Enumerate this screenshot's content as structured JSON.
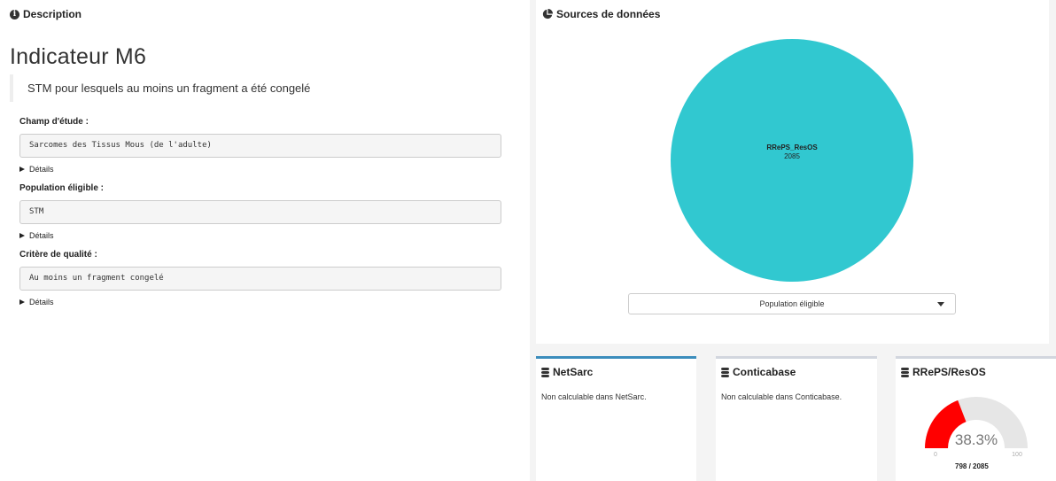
{
  "description": {
    "header": "Description",
    "title": "Indicateur M6",
    "quote": "STM pour lesquels au moins un fragment a été congelé",
    "fields": [
      {
        "label": "Champ d'étude :",
        "value": "Sarcomes des Tissus Mous (de l'adulte)",
        "details": "Détails"
      },
      {
        "label": "Population éligible :",
        "value": "STM",
        "details": "Détails"
      },
      {
        "label": "Critère de qualité :",
        "value": "Au moins un fragment congelé",
        "details": "Détails"
      }
    ]
  },
  "sources": {
    "header": "Sources de données",
    "select_value": "Population éligible",
    "chart_data": {
      "type": "pie",
      "slices": [
        {
          "label": "RRePS_ResOS",
          "value": 2085,
          "color": "#31c8d0"
        }
      ]
    }
  },
  "cards": [
    {
      "title": "NetSarc",
      "text": "Non calculable dans NetSarc.",
      "active": true
    },
    {
      "title": "Conticabase",
      "text": "Non calculable dans Conticabase.",
      "active": false
    },
    {
      "title": "RRePS/ResOS",
      "gauge": {
        "percent_label": "38.3%",
        "percent": 38.3,
        "min_label": "0",
        "max_label": "100",
        "ratio": "798 / 2085",
        "fill_color": "#ff0000",
        "track_color": "#e6e6e6"
      }
    }
  ]
}
